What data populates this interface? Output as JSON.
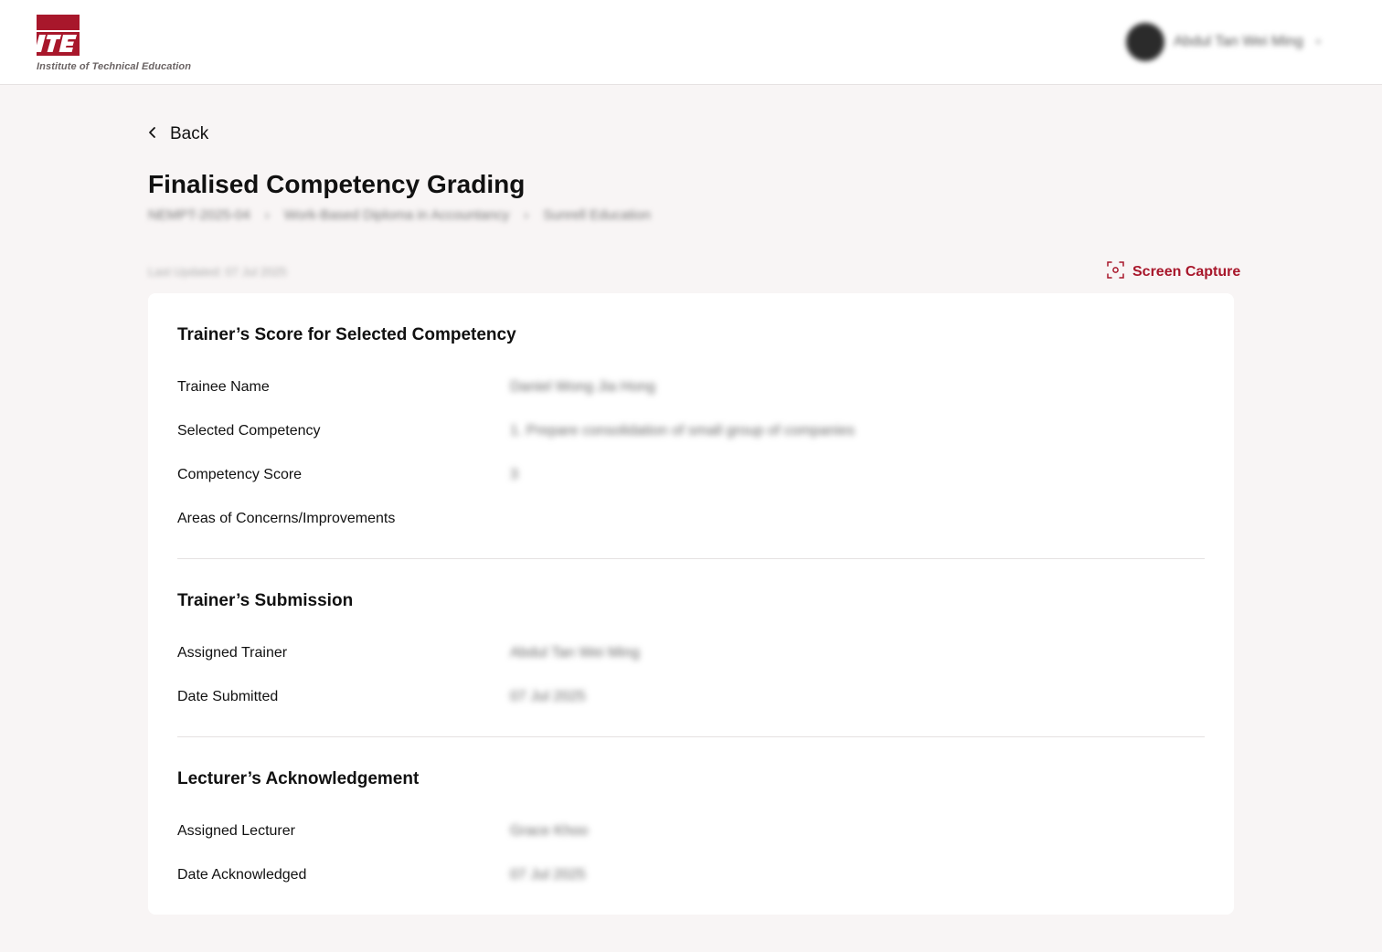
{
  "header": {
    "logo_text": "Institute of Technical Education",
    "logo_mark": "ITE",
    "user_name": "Abdul Tan Wei Ming",
    "avatar_icon": "avatar",
    "brand_color": "#a8172b"
  },
  "nav": {
    "back_label": "Back"
  },
  "page": {
    "title": "Finalised Competency Grading",
    "breadcrumb": [
      "NEMPT-2025-04",
      "Work-Based Diploma in Accountancy",
      "Sunrell Education"
    ],
    "updated": "Last Updated: 07 Jul 2025",
    "screen_capture_label": "Screen Capture"
  },
  "trainer_score": {
    "title": "Trainer’s Score for Selected Competency",
    "rows": [
      {
        "label": "Trainee Name",
        "value": "Daniel Wong Jia Hong"
      },
      {
        "label": "Selected Competency",
        "value": "1. Prepare consolidation of small group of companies"
      },
      {
        "label": "Competency Score",
        "value": "3"
      },
      {
        "label": "Areas of Concerns/Improvements",
        "value": ""
      }
    ]
  },
  "trainer_submission": {
    "title": "Trainer’s Submission",
    "rows": [
      {
        "label": "Assigned Trainer",
        "value": "Abdul Tan Wei Ming"
      },
      {
        "label": "Date Submitted",
        "value": "07 Jul 2025"
      }
    ]
  },
  "lecturer_ack": {
    "title": "Lecturer’s Acknowledgement",
    "rows": [
      {
        "label": "Assigned Lecturer",
        "value": "Grace Khoo"
      },
      {
        "label": "Date Acknowledged",
        "value": "07 Jul 2025"
      }
    ]
  }
}
